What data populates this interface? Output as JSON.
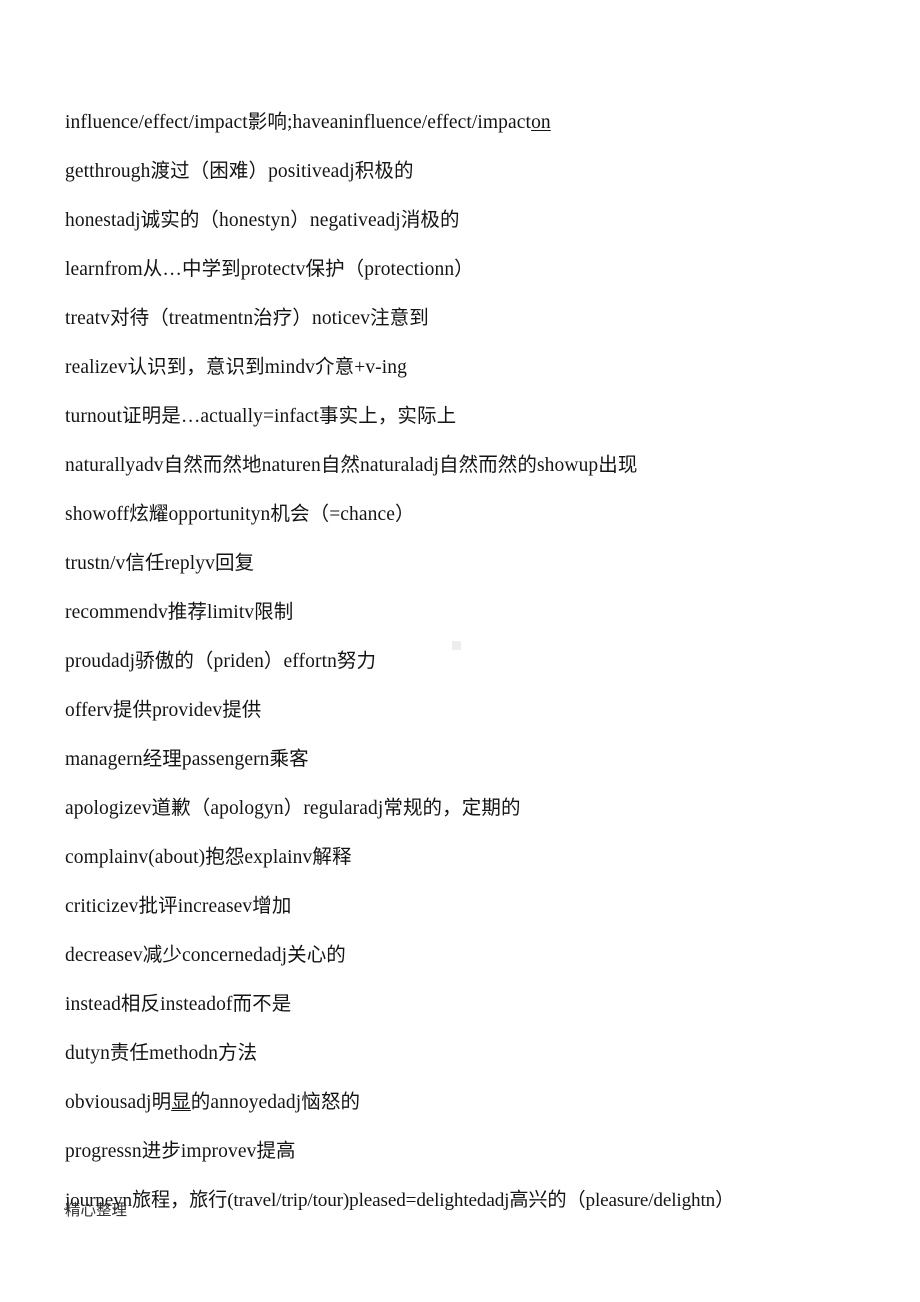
{
  "document": {
    "page_background": "#ffffff",
    "text_color": "#141414",
    "footer_note": "精心整理",
    "lines": [
      {
        "id": "line-1",
        "text": "influence/effect/impact影响;haveaninfluence/effect/impact",
        "underlined_tail": "on"
      },
      {
        "id": "line-2",
        "text": "getthrough渡过（困难）positiveadj积极的"
      },
      {
        "id": "line-3",
        "text": "honestadj诚实的（honestyn）negativeadj消极的"
      },
      {
        "id": "line-4",
        "text": "learnfrom从…中学到protectv保护（protectionn）"
      },
      {
        "id": "line-5",
        "text": "treatv对待（treatmentn治疗）noticev注意到"
      },
      {
        "id": "line-6",
        "text": "realizev认识到，意识到mindv介意+v-ing"
      },
      {
        "id": "line-7",
        "text": "turnout证明是…actually=infact事实上，实际上"
      },
      {
        "id": "line-8",
        "text": "naturallyadv自然而然地naturen自然naturaladj自然而然的showup出现"
      },
      {
        "id": "line-9",
        "text": "showoff炫耀opportunityn机会（=chance）"
      },
      {
        "id": "line-10",
        "text": "trustn/v信任replyv回复"
      },
      {
        "id": "line-11",
        "text": "recommendv推荐limitv限制"
      },
      {
        "id": "line-12",
        "text": "proudadj骄傲的（priden）effortn努力"
      },
      {
        "id": "line-13",
        "text": "offerv提供providev提供"
      },
      {
        "id": "line-14",
        "text": "managern经理passengern乘客"
      },
      {
        "id": "line-15",
        "text": "apologizev道歉（apologyn）regularadj常规的，定期的"
      },
      {
        "id": "line-16",
        "text": "complainv(about)抱怨explainv解释"
      },
      {
        "id": "line-17",
        "text": "criticizev批评increasev增加"
      },
      {
        "id": "line-18",
        "text": "decreasev减少concernedadj关心的"
      },
      {
        "id": "line-19",
        "text": "instead相反insteadof而不是"
      },
      {
        "id": "line-20",
        "text": "dutyn责任methodn方法"
      },
      {
        "id": "line-21",
        "prefix": "obviousadj明",
        "underlined_mid": "显",
        "suffix": "的annoyedadj恼怒的"
      },
      {
        "id": "line-22",
        "text": "progressn进步improvev提高"
      },
      {
        "id": "line-23",
        "text": "journeyn旅程，旅行(travel/trip/tour)pleased=delightedadj高兴的（pleasure/delightn）"
      }
    ]
  }
}
